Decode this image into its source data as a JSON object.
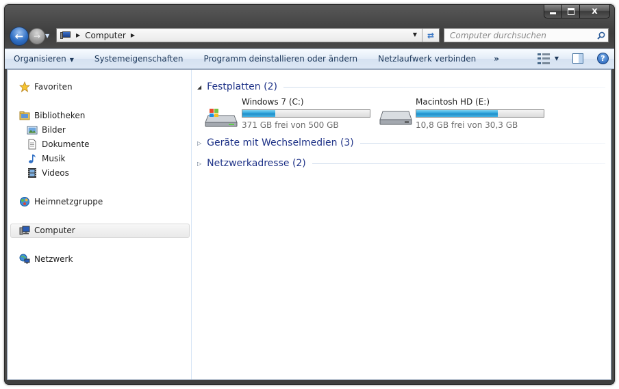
{
  "window": {
    "caption": {
      "close_label": "x"
    }
  },
  "address": {
    "location": "Computer"
  },
  "search": {
    "placeholder": "Computer durchsuchen"
  },
  "toolbar": {
    "organize": "Organisieren",
    "properties": "Systemeigenschaften",
    "uninstall": "Programm deinstallieren oder ändern",
    "map_drive": "Netzlaufwerk verbinden",
    "more": "»"
  },
  "sidebar": {
    "favorites": "Favoriten",
    "libraries": "Bibliotheken",
    "pictures": "Bilder",
    "documents": "Dokumente",
    "music": "Musik",
    "videos": "Videos",
    "homegroup": "Heimnetzgruppe",
    "computer": "Computer",
    "network": "Netzwerk"
  },
  "groups": {
    "hard_drives": "Festplatten (2)",
    "removable": "Geräte mit Wechselmedien (3)",
    "network": "Netzwerkadresse (2)"
  },
  "drives": [
    {
      "name": "Windows 7 (C:)",
      "free": "371 GB frei von 500 GB",
      "used_fraction": 0.26
    },
    {
      "name": "Macintosh HD (E:)",
      "free": "10,8 GB frei von 30,3 GB",
      "used_fraction": 0.64
    }
  ],
  "colors": {
    "group_title": "#1e3287",
    "bar_fill": "#26a0da"
  }
}
